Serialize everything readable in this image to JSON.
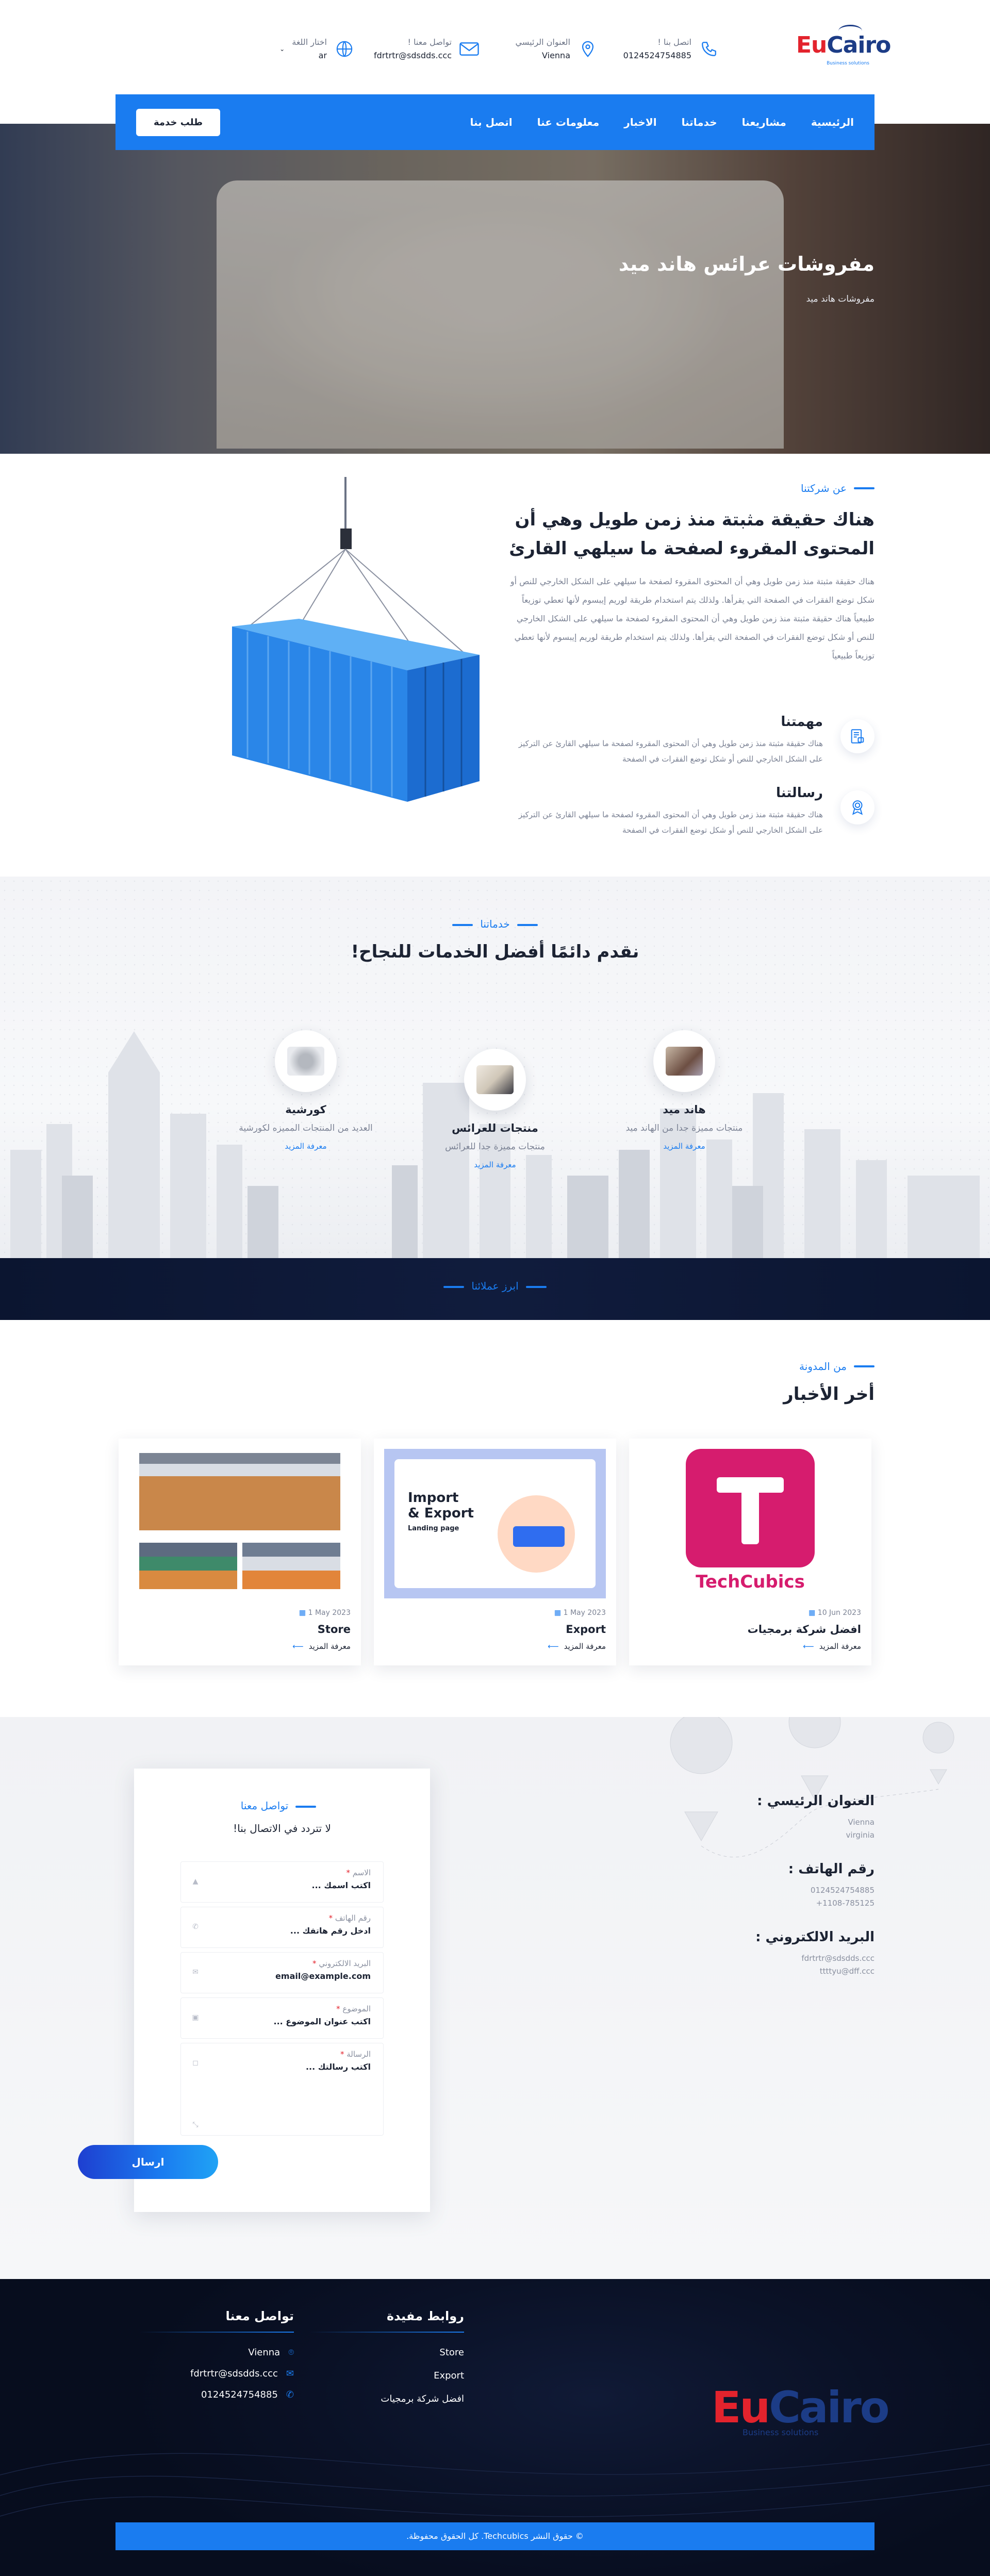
{
  "brand": {
    "logo_eu": "Eu",
    "logo_cairo": "Cairo",
    "logo_tagline": "Business solutions"
  },
  "header": {
    "phone_label": "اتصل بنا !",
    "phone_value": "0124524754885",
    "address_label": "العنوان الرئيسي",
    "address_value": "Vienna",
    "email_label": "تواصل معنا !",
    "email_value": "fdrtrtr@sdsdds.ccc",
    "lang_label": "اختار اللغة",
    "lang_value": "ar"
  },
  "nav": {
    "items": [
      "الرئيسية",
      "مشاريعنا",
      "خدماتنا",
      "الاخبار",
      "معلومات عنا",
      "اتصل بنا"
    ],
    "service_button": "طلب خدمة"
  },
  "hero": {
    "title": "مفروشات عرائس هاند ميد",
    "breadcrumb": "مفروشات هاند ميد"
  },
  "about": {
    "label": "عن شركتنا",
    "title": "هناك حقيقة مثبتة منذ زمن طويل وهي أن المحتوى المقروء لصفحة ما سيلهي القارئ",
    "text": "هناك حقيقة مثبتة منذ زمن طويل وهي أن المحتوى المقروء لصفحة ما سيلهي على الشكل الخارجي للنص أو شكل توضع الفقرات في الصفحة التي يقرأها. ولذلك يتم استخدام طريقة لوريم إيبسوم لأنها تعطي توزيعاً طبيعياً هناك حقيقة مثبتة منذ زمن طويل وهي أن المحتوى المقروء لصفحة ما سيلهي على الشكل الخارجي للنص أو شكل توضع الفقرات في الصفحة التي يقرأها. ولذلك يتم استخدام طريقة لوريم إيبسوم لأنها تعطي توزيعاً طبيعياً",
    "mission_title": "مهمتنا",
    "mission_text": "هناك حقيقة مثبتة منذ زمن طويل وهي أن المحتوى المقروء لصفحة ما سيلهي القارئ عن التركيز على الشكل الخارجي للنص أو شكل توضع الفقرات في الصفحة",
    "message_title": "رسالتنا",
    "message_text": "هناك حقيقة مثبتة منذ زمن طويل وهي أن المحتوى المقروء لصفحة ما سيلهي القارئ عن التركيز على الشكل الخارجي للنص أو شكل توضع الفقرات في الصفحة"
  },
  "services": {
    "label": "خدماتنا",
    "title": "نقدم دائمًا أفضل الخدمات للنجاح!",
    "items": [
      {
        "title": "هاند ميد",
        "desc": "منتجات مميزة جدا من الهاند ميد",
        "more": "معرفة المزيد"
      },
      {
        "title": "منتجات للعرائس",
        "desc": "منتجات مميزة جدا للعرائس",
        "more": "معرفة المزيد"
      },
      {
        "title": "كورشية",
        "desc": "العديد من المنتجات المميزه لكورشية",
        "more": "معرفة المزيد"
      }
    ]
  },
  "works": {
    "label": "ابرز عملائنا"
  },
  "blog": {
    "label": "من المدونة",
    "title": "أخر الأخبار",
    "posts": [
      {
        "date": "10 Jun 2023",
        "title": "افضل شركة برمجيات",
        "more": "معرفة المزيد",
        "image_text": "TechCubics"
      },
      {
        "date": "1 May 2023",
        "title": "Export",
        "more": "معرفة المزيد",
        "image_text_1": "Import",
        "image_text_2": "& Export",
        "image_text_3": "Landing page"
      },
      {
        "date": "1 May 2023",
        "title": "Store",
        "more": "معرفة المزيد"
      }
    ]
  },
  "contact_info": {
    "address_title": "العنوان الرئيسي :",
    "address_line1": "Vienna",
    "address_line2": "virginia",
    "phone_title": "رقم الهاتف :",
    "phone_line1": "0124524754885",
    "phone_line2": "+1108-785125",
    "email_title": "البريد الالكتروني :",
    "email_line1": "fdrtrtr@sdsdds.ccc",
    "email_line2": "ttttyu@dff.ccc"
  },
  "form": {
    "label": "تواصل معنا",
    "subtitle": "لا تتردد في الاتصال بنا!",
    "name_label": "الاسم",
    "name_placeholder": "اكتب اسمك ...",
    "phone_label": "رقم الهاتف",
    "phone_placeholder": "ادخل رقم هاتفك ...",
    "email_label": "البريد الالكتروني",
    "email_placeholder": "email@example.com",
    "subject_label": "الموضوع",
    "subject_placeholder": "اكتب عنوان الموضوع ...",
    "message_label": "الرسالة",
    "message_placeholder": "اكتب رسالتك ...",
    "required_mark": "*",
    "send_button": "ارسال"
  },
  "footer": {
    "links_title": "روابط مفيدة",
    "links": [
      "Store",
      "Export",
      "افضل شركة برمجيات"
    ],
    "contact_title": "تواصل معنا",
    "contact_city": "Vienna",
    "contact_email": "fdrtrtr@sdsdds.ccc",
    "contact_phone": "0124524754885",
    "logo_tagline": "Business solutions",
    "copyright": "© حقوق النشر Techcubics. كل الحقوق محفوظة."
  },
  "colors": {
    "accent": "#1a7cf0",
    "brand_red": "#e3232d",
    "brand_navy": "#1c3c86",
    "footer_bg": "#0a1126"
  }
}
